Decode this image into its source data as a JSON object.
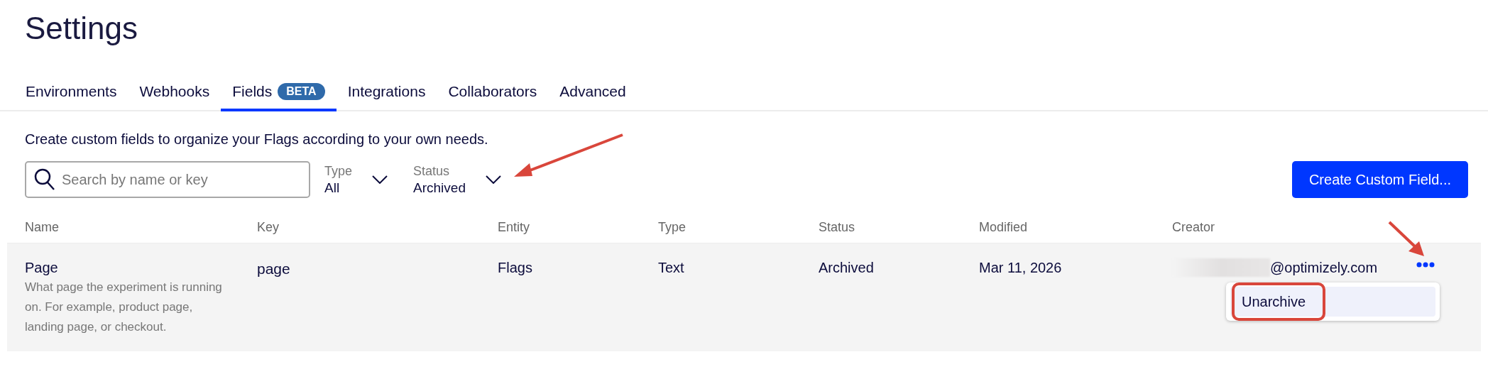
{
  "title": "Settings",
  "tabs": [
    {
      "label": "Environments",
      "selected": false
    },
    {
      "label": "Webhooks",
      "selected": false
    },
    {
      "label": "Fields",
      "badge": "BETA",
      "selected": true
    },
    {
      "label": "Integrations",
      "selected": false
    },
    {
      "label": "Collaborators",
      "selected": false
    },
    {
      "label": "Advanced",
      "selected": false
    }
  ],
  "description": "Create custom fields to organize your Flags according to your own needs.",
  "search": {
    "placeholder": "Search by name or key"
  },
  "filters": [
    {
      "label": "Type",
      "value": "All"
    },
    {
      "label": "Status",
      "value": "Archived"
    }
  ],
  "create_button": "Create Custom Field...",
  "table": {
    "columns": [
      "Name",
      "Key",
      "Entity",
      "Type",
      "Status",
      "Modified",
      "Creator"
    ],
    "rows": [
      {
        "name": "Page",
        "description": "What page the experiment is running on. For example, product page, landing page, or checkout.",
        "key": "page",
        "entity": "Flags",
        "type": "Text",
        "status": "Archived",
        "modified": "Mar 11, 2026",
        "creator": "@optimizely.com",
        "creator_redacted": true
      }
    ]
  },
  "row_menu": [
    {
      "label": "Unarchive",
      "highlighted": true
    }
  ]
}
